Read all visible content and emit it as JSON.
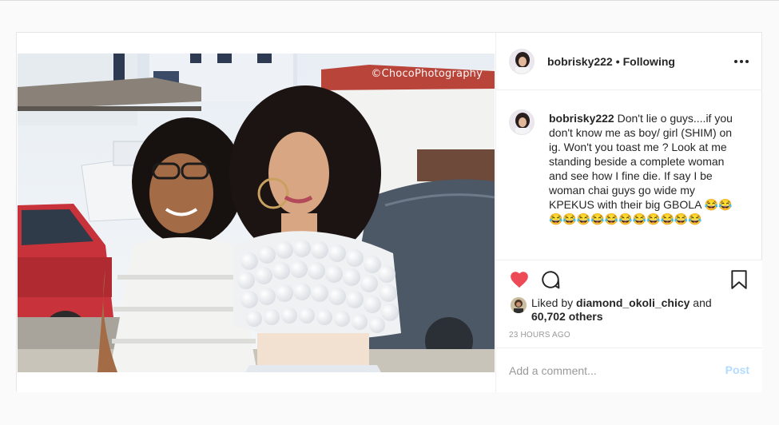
{
  "post": {
    "watermark": "©ChocoPhotography",
    "photo_alt": "Two women posing outdoors"
  },
  "header": {
    "username": "bobrisky222",
    "separator": "•",
    "follow_status": "Following",
    "more_icon": "more-horizontal-icon"
  },
  "caption": {
    "username": "bobrisky222",
    "text": " Don't lie o guys....if you don't know me as boy/ girl (SHIM) on ig. Won't you toast me ? Look at me standing beside a complete woman and see how I fine die. If say I be woman chai guys go wide my KPEKUS with their big GBOLA 😂😂😂😂😂😂😂😂😂😂😂😂😂",
    "time": "23h"
  },
  "actions": {
    "like_icon": "heart-filled-icon",
    "comment_icon": "comment-icon",
    "save_icon": "bookmark-icon",
    "like_color": "#ed4956"
  },
  "likes": {
    "prefix": "Liked by ",
    "liker": "diamond_okoli_chicy",
    "middle": " and",
    "count": "60,702 others"
  },
  "timestamp": "23 HOURS AGO",
  "comment_box": {
    "placeholder": "Add a comment...",
    "post_label": "Post"
  },
  "colors": {
    "post_disabled": "#b3dbff",
    "secondary_text": "#999999"
  }
}
